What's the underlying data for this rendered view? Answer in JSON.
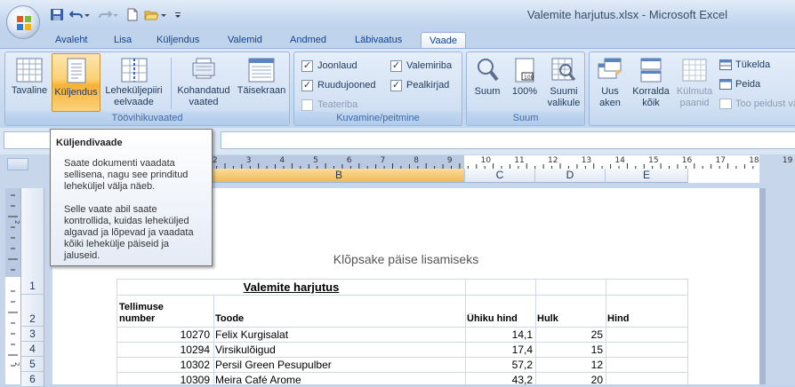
{
  "window": {
    "title": "Valemite harjutus.xlsx - Microsoft Excel"
  },
  "tabs": [
    "Avaleht",
    "Lisa",
    "Küljendus",
    "Valemid",
    "Andmed",
    "Läbivaatus",
    "Vaade"
  ],
  "active_tab": "Vaade",
  "ribbon": {
    "workbook_views": {
      "label": "Töövihikuvaated",
      "normal": "Tavaline",
      "page_layout": "Küljendus",
      "page_break_l1": "Leheküljepiiri",
      "page_break_l2": "eelvaade",
      "custom_l1": "Kohandatud",
      "custom_l2": "vaated",
      "fullscreen": "Täisekraan"
    },
    "show_hide": {
      "label": "Kuvamine/peitmine",
      "ruler": "Joonlaud",
      "gridlines": "Ruudujooned",
      "message_bar": "Teateriba",
      "formula_bar": "Valemiriba",
      "headings": "Pealkirjad"
    },
    "zoom": {
      "label": "Suum",
      "zoom": "Suum",
      "zoom100": "100%",
      "sel_l1": "Suumi",
      "sel_l2": "valikule"
    },
    "window": {
      "new_l1": "Uus",
      "new_l2": "aken",
      "arrange_l1": "Korralda",
      "arrange_l2": "kõik",
      "freeze_l1": "Külmuta",
      "freeze_l2": "paanid",
      "split": "Tükelda",
      "hide": "Peida",
      "unhide": "Too peidust vä"
    }
  },
  "tooltip": {
    "title": "Küljendivaade",
    "p1_l1": "Saate dokumenti vaadata",
    "p1_l2": "sellisena, nagu see prinditud",
    "p1_l3": "leheküljel välja näeb.",
    "p2_l1": "Selle vaate abil saate",
    "p2_l2": "kontrollida, kuidas leheküljed",
    "p2_l3": "algavad ja lõpevad ja vaadata",
    "p2_l4": "kõiki lehekülje päiseid ja",
    "p2_l5": "jaluseid."
  },
  "columns": [
    "B",
    "C",
    "D",
    "E"
  ],
  "ruler_numbers": [
    "2",
    "3",
    "4",
    "5",
    "6",
    "7",
    "8",
    "9",
    "10",
    "11",
    "12",
    "13",
    "14",
    "15",
    "16",
    "17",
    "18",
    "19"
  ],
  "header_prompt": "Klõpsake päise lisamiseks",
  "sheet": {
    "title": "Valemite harjutus",
    "headers": {
      "order_l1": "Tellimuse",
      "order_l2": "number",
      "product": "Toode",
      "unit_price": "Ühiku hind",
      "qty": "Hulk",
      "price": "Hind"
    },
    "rows": [
      {
        "row": "3",
        "order": "10270",
        "product": "Felix Kurgisalat",
        "unit_price": "14,1",
        "qty": "25"
      },
      {
        "row": "4",
        "order": "10294",
        "product": "Virsikulõigud",
        "unit_price": "17,4",
        "qty": "15"
      },
      {
        "row": "5",
        "order": "10302",
        "product": "Persil Green Pesupulber",
        "unit_price": "57,2",
        "qty": "12"
      },
      {
        "row": "6",
        "order": "10309",
        "product": "Meira Café Arome",
        "unit_price": "43,2",
        "qty": "20"
      }
    ],
    "row_labels": {
      "r1": "1",
      "r2": "2"
    }
  }
}
